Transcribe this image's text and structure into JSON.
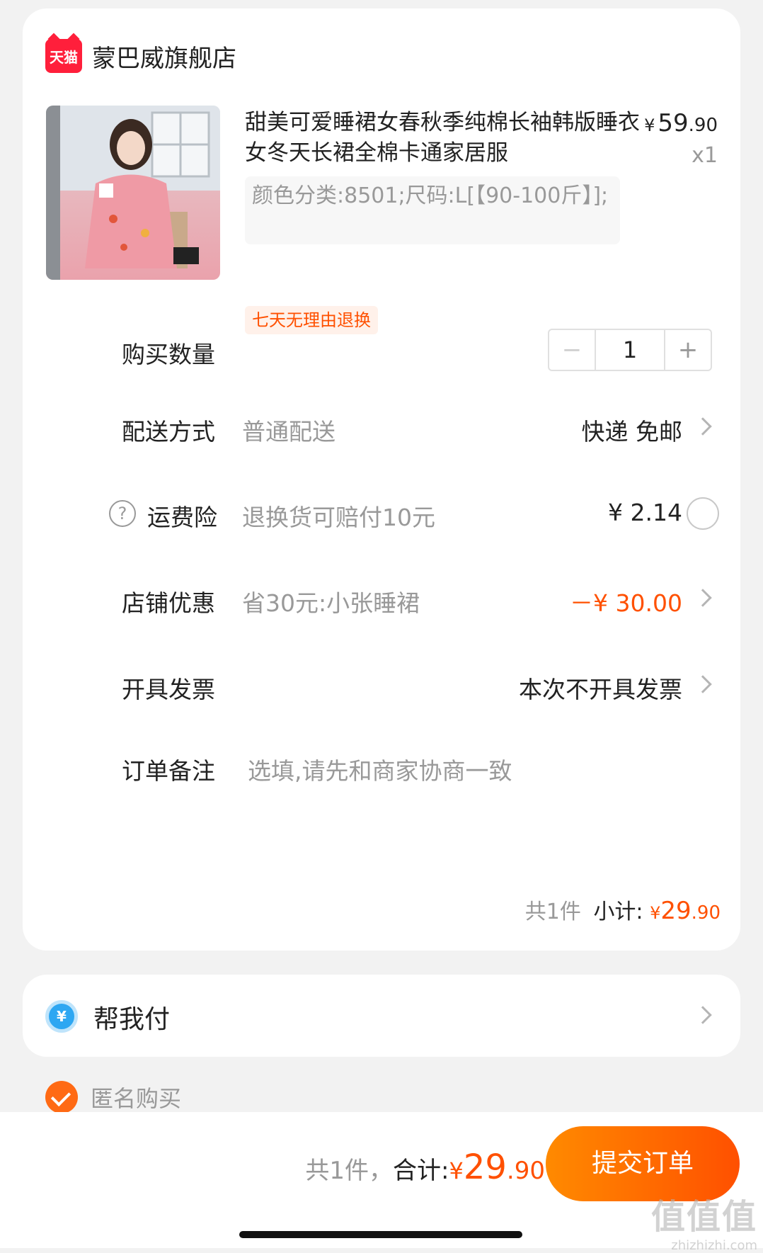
{
  "shop": {
    "logo_text": "天猫",
    "name": "蒙巴威旗舰店"
  },
  "product": {
    "title": "甜美可爱睡裙女春秋季纯棉长袖韩版睡衣女冬天长裙全棉卡通家居服",
    "price_symbol": "¥",
    "price_int": "59",
    "price_dec": ".90",
    "quantity": "x1",
    "sku": "颜色分类:8501;尺码:L[【90-100斤】];",
    "service_tag": "七天无理由退换",
    "image_icon": "product-photo"
  },
  "rows": {
    "quantity": {
      "label": "购买数量",
      "value": "1",
      "minus": "−",
      "plus": "+"
    },
    "delivery": {
      "label": "配送方式",
      "desc": "普通配送",
      "value": "快递 免邮"
    },
    "insurance": {
      "label": "运费险",
      "desc": "退换货可赔付10元",
      "value": "¥ 2.14",
      "help": "?"
    },
    "discount": {
      "label": "店铺优惠",
      "desc": "省30元:小张睡裙",
      "value": "－¥ 30.00"
    },
    "invoice": {
      "label": "开具发票",
      "value": "本次不开具发票"
    },
    "remark": {
      "label": "订单备注",
      "placeholder": "选填,请先和商家协商一致"
    }
  },
  "subtotal": {
    "count": "共1件",
    "label": "小计:",
    "symbol": "¥",
    "int": "29",
    "dec": ".90"
  },
  "help_pay": {
    "icon": "¥",
    "label": "帮我付"
  },
  "anonymous": {
    "label": "匿名购买",
    "checked": true
  },
  "bottom": {
    "count": "共1件，",
    "label": "合计:",
    "symbol": "¥",
    "int": "29",
    "dec": ".90",
    "submit": "提交订单"
  },
  "watermark": {
    "main": "值值值",
    "sub": "zhizhizhi.com"
  },
  "colors": {
    "accent": "#ff5000",
    "background": "#f2f2f2",
    "tmall_red": "#ff1f3b"
  }
}
